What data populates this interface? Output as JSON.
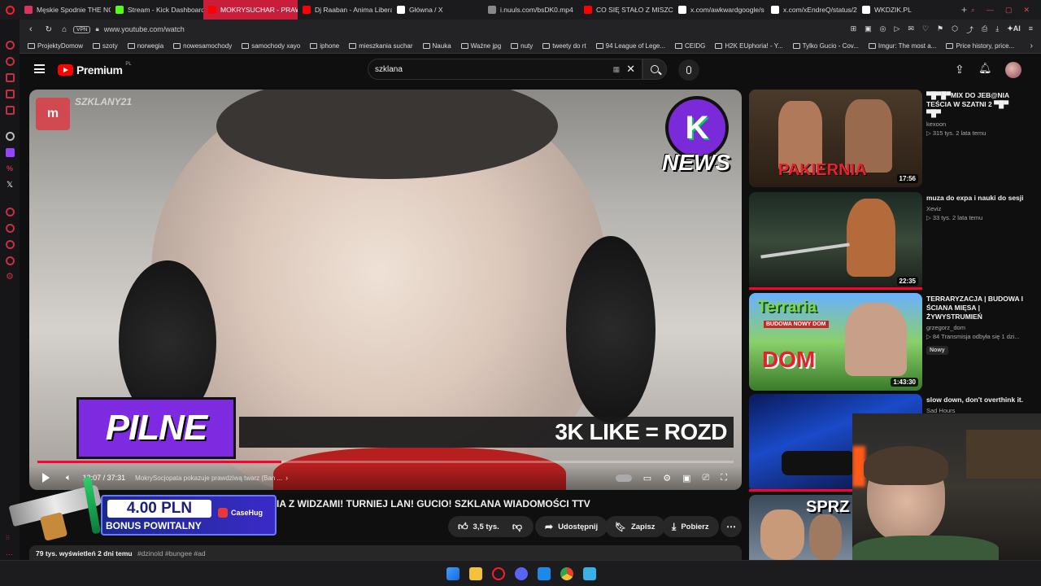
{
  "tabs": [
    {
      "label": "Męskie Spodnie THE NORTH",
      "icon": "store-icon",
      "color": "#d8355a"
    },
    {
      "label": "Stream - Kick Dashboard",
      "icon": "kick-icon",
      "color": "#53fc18"
    },
    {
      "label": "MOKRYSUCHAR - PRAWDA",
      "icon": "youtube-icon",
      "color": "#ff0000",
      "active": true
    },
    {
      "label": "Dj Raaban - Anima Libera",
      "icon": "youtube-icon",
      "color": "#ff0000"
    },
    {
      "label": "Główna / X",
      "icon": "x-icon",
      "color": "#ffffff"
    },
    {
      "label": "i.nuuls.com/bsDK0.mp4",
      "icon": "file-icon",
      "color": "#888888"
    },
    {
      "label": "CO SIĘ STAŁO Z MISZCZ",
      "icon": "youtube-icon",
      "color": "#ff0000"
    },
    {
      "label": "x.com/awkwardgoogle/s",
      "icon": "x-icon",
      "color": "#ffffff"
    },
    {
      "label": "x.com/xEndreQ/status/2",
      "icon": "x-icon",
      "color": "#ffffff"
    },
    {
      "label": "WKDZIK.PL",
      "icon": "wk-icon",
      "color": "#ffffff"
    }
  ],
  "address": {
    "vpn": "VPN",
    "url": "www.youtube.com/watch"
  },
  "bookmarks": [
    "ProjektyDomow",
    "szoty",
    "norwegia",
    "nowesamochody",
    "samochody xayo",
    "iphone",
    "mieszkania suchar",
    "Nauka",
    "Ważne jpg",
    "nuty",
    "tweety do rt",
    "94 League of Lege...",
    "CEIDG",
    "H2K EUphoria! - Y...",
    "Tylko Gucio - Cov...",
    "Imgur: The most a...",
    "Price history, price..."
  ],
  "header": {
    "logo": "Premium",
    "logo_sup": "PL",
    "search_value": "szklana",
    "kbd": "▦"
  },
  "player": {
    "watermark": "SZKLANY21",
    "news_badge": "K",
    "news_text": "NEWS",
    "pilne": "PILNE",
    "ticker": "3K LIKE = ROZD",
    "time": "13:07 / 37:31",
    "chapter": "MokrySocjopata pokazuje prawdziwą twarz (Ban ...",
    "progress": 0.35
  },
  "video": {
    "title": "IA Z WIDZAMI! TURNIEJ LAN! GUCIO! SZKLANA WIADOMOŚCI TTV",
    "likes": "3,5 tys.",
    "share": "Udostępnij",
    "save": "Zapisz",
    "download": "Pobierz",
    "views": "79 tys. wyświetleń  2 dni temu",
    "tags": "#dzinold #bungee #ad"
  },
  "ad": {
    "amount": "4.00 PLN",
    "bonus": "BONUS POWITALNY",
    "brand": "CaseHug"
  },
  "sidebar": [
    {
      "title": "▀█▀█▀MIX DO JEB@NIA TEŚCIA W SZATNI 2 ▀█▀ ▀█▀",
      "channel": "kexoon",
      "meta": "▷ 315 tys.  2 lata temu",
      "duration": "17:56",
      "thumb_text": "PAKIERNIA"
    },
    {
      "title": "muza do expa i nauki do sesji",
      "channel": "Xeviz",
      "meta": "▷ 33 tys.  2 lata temu",
      "duration": "22:35"
    },
    {
      "title": "TERRARYZACJA | BUDOWA I ŚCIANA MIĘSA | ŻYWYSTRUMIEŃ",
      "channel": "grzegorz_dom",
      "meta": "▷ 84  Transmisja odbyła się 1 dzi...",
      "badge": "Nowy",
      "duration": "1:43:30",
      "thumb_text": "Terraria",
      "thumb_sub": "BUDOWA NOWY DOM",
      "thumb_big": "DOM"
    },
    {
      "title": "slow down, don't overthink it.",
      "channel": "Sad Hours",
      "meta": ""
    },
    {
      "title": "",
      "channel": "",
      "meta": "",
      "thumb_text": "SPRZ"
    }
  ]
}
